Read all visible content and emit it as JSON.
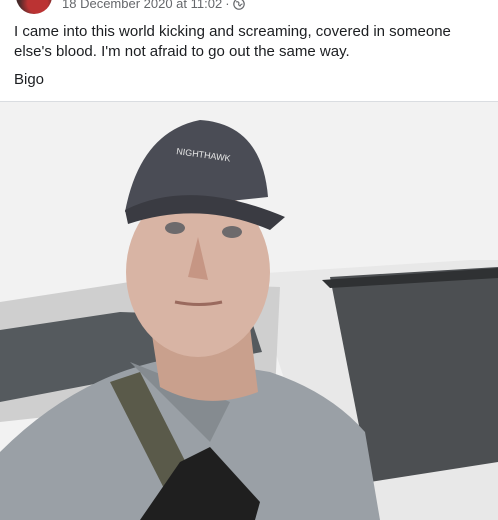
{
  "post": {
    "date": "18 December 2020 at 11:02",
    "separator": "·",
    "privacy_icon": "globe-icon",
    "text": "I came into this world kicking and screaming, covered in someone else's blood.  I'm not afraid to go out the same way.",
    "signature": "Bigo"
  },
  "photo": {
    "cap_brand": "NIGHTHAWK"
  },
  "colors": {
    "meta_text": "#65676b",
    "body_text": "#1c1e21",
    "divider": "#dadde1"
  }
}
